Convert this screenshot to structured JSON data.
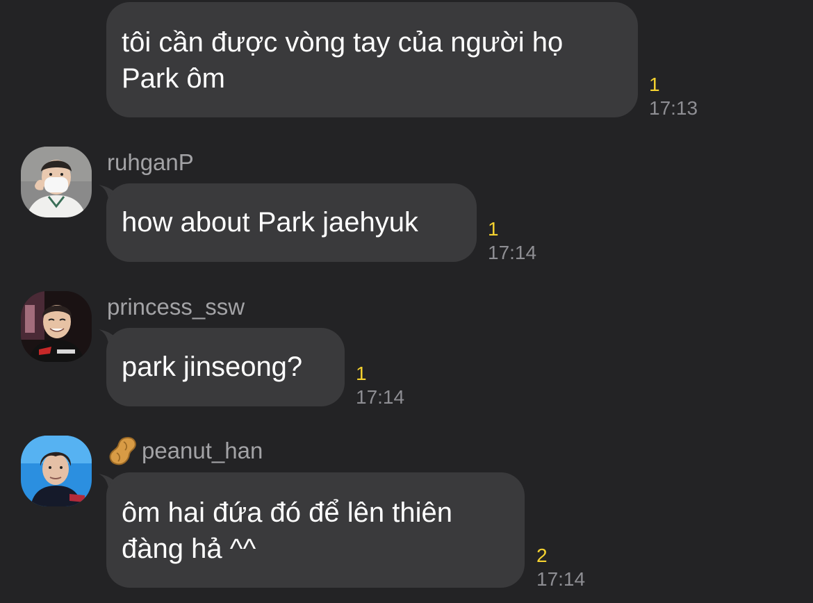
{
  "messages": [
    {
      "sender": "",
      "lines": [
        "tôi cần được vòng tay của người họ",
        "Park ôm"
      ],
      "unread": "1",
      "time": "17:13"
    },
    {
      "sender": "ruhganP",
      "avatar": "avatar-masked-person",
      "lines": [
        "how about Park jaehyuk"
      ],
      "unread": "1",
      "time": "17:14"
    },
    {
      "sender": "princess_ssw",
      "avatar": "avatar-smiling-person",
      "lines": [
        "park jinseong?"
      ],
      "unread": "1",
      "time": "17:14"
    },
    {
      "sender": "peanut_han",
      "sender_icon": "peanut-icon",
      "avatar": "avatar-person-blue-background",
      "lines": [
        "ôm hai đứa đó để lên thiên",
        "đàng hả ^^"
      ],
      "unread": "2",
      "time": "17:14"
    }
  ],
  "colors": {
    "background": "#232325",
    "bubble": "#3a3a3c",
    "unread": "#f5d230",
    "time": "#8e8e93",
    "sender": "#a3a3a6"
  }
}
